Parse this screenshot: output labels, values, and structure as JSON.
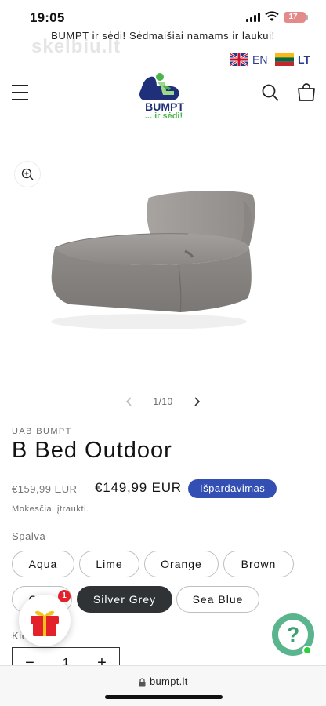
{
  "status_bar": {
    "time": "19:05",
    "battery": "17"
  },
  "announcement": "BUMPT ir sėdi! Sėdmaišiai namams ir laukui!",
  "watermark": "skelbiu.lt",
  "languages": [
    {
      "code": "EN",
      "flag": "uk-flag-icon"
    },
    {
      "code": "LT",
      "flag": "lithuania-flag-icon"
    }
  ],
  "header": {
    "logo_text": "BUMPT",
    "logo_sub": "... ir sėdi!",
    "brand_colors": {
      "navy": "#1f2f7a",
      "green": "#48b649"
    }
  },
  "gallery": {
    "counter": "1/10"
  },
  "product": {
    "vendor": "UAB BUMPT",
    "title": "B Bed Outdoor",
    "price_old": "€159,99 EUR",
    "price_new": "€149,99 EUR",
    "sale_badge": "Išpardavimas",
    "tax_note": "Mokesčiai įtraukti.",
    "color_label": "Spalva",
    "colors": [
      "Aqua",
      "Lime",
      "Orange",
      "Brown",
      "Grey",
      "Silver Grey",
      "Sea Blue"
    ],
    "selected_color": "Silver Grey",
    "quantity_label": "Kiekis",
    "quantity_minus": "−",
    "quantity": "1",
    "quantity_plus": "+"
  },
  "widgets": {
    "gift_badge": "1",
    "help_symbol": "?"
  },
  "browser": {
    "url": "bumpt.lt"
  },
  "colors": {
    "sale_badge": "#334fb4",
    "selected_swatch": "#2f3336",
    "help": "#5ab58f"
  }
}
